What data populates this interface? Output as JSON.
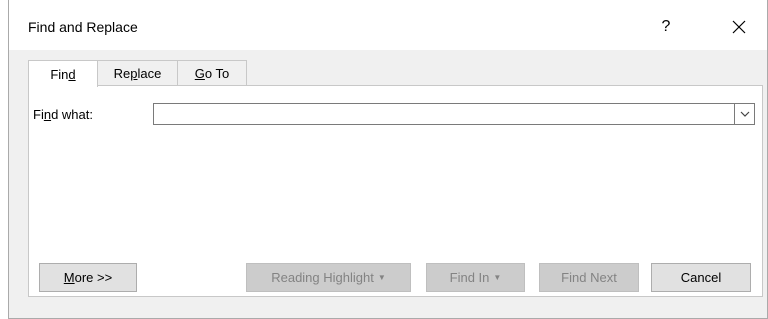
{
  "window": {
    "title": "Find and Replace",
    "help_label": "?"
  },
  "tabs": [
    {
      "label_pre": "Fin",
      "label_ul": "d",
      "label_post": "",
      "active": true
    },
    {
      "label_pre": "Re",
      "label_ul": "p",
      "label_post": "lace",
      "active": false
    },
    {
      "label_pre": "",
      "label_ul": "G",
      "label_post": "o To",
      "active": false
    }
  ],
  "find": {
    "label_pre": "Fi",
    "label_ul": "n",
    "label_post": "d what:",
    "value": ""
  },
  "buttons": {
    "more_ul": "M",
    "more_rest": "ore >>",
    "reading_highlight": "Reading Highlight",
    "find_in": "Find In",
    "find_next": "Find Next",
    "cancel": "Cancel"
  }
}
